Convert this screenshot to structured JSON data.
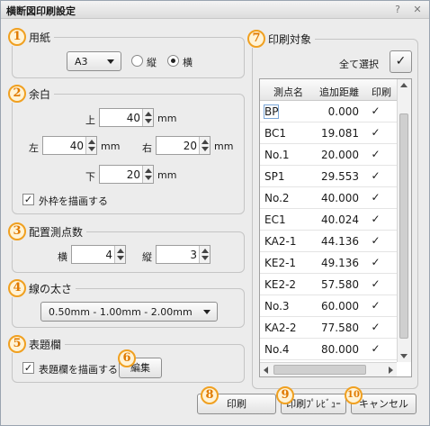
{
  "window": {
    "title": "横断図印刷設定",
    "help_icon": "?",
    "close_icon": "✕"
  },
  "paper": {
    "num": "1",
    "label": "用紙",
    "size_options": [
      "A3"
    ],
    "size_value": "A3",
    "orientation_portrait": "縦",
    "orientation_landscape": "横",
    "orientation_selected": "横"
  },
  "margin": {
    "num": "2",
    "label": "余白",
    "top_label": "上",
    "top_value": "40",
    "left_label": "左",
    "left_value": "40",
    "right_label": "右",
    "right_value": "20",
    "bottom_label": "下",
    "bottom_value": "20",
    "unit": "mm",
    "frame_check_label": "外枠を描画する",
    "frame_checked": true
  },
  "layout": {
    "num": "3",
    "label": "配置測点数",
    "horizontal_label": "横",
    "horizontal_value": "4",
    "vertical_label": "縦",
    "vertical_value": "3"
  },
  "line_width": {
    "num": "4",
    "label": "線の太さ",
    "value": "0.50mm - 1.00mm - 2.00mm"
  },
  "title_block": {
    "num": "5",
    "label": "表題欄",
    "draw_label": "表題欄を描画する",
    "draw_checked": true,
    "edit_num": "6",
    "edit_label": "編集"
  },
  "targets": {
    "num": "7",
    "label": "印刷対象",
    "select_all_label": "全て選択",
    "columns": [
      "測点名",
      "追加距離",
      "印刷"
    ],
    "rows": [
      {
        "name": "BP",
        "dist": "0.000",
        "print": "✓"
      },
      {
        "name": "BC1",
        "dist": "19.081",
        "print": "✓"
      },
      {
        "name": "No.1",
        "dist": "20.000",
        "print": "✓"
      },
      {
        "name": "SP1",
        "dist": "29.553",
        "print": "✓"
      },
      {
        "name": "No.2",
        "dist": "40.000",
        "print": "✓"
      },
      {
        "name": "EC1",
        "dist": "40.024",
        "print": "✓"
      },
      {
        "name": "KA2-1",
        "dist": "44.136",
        "print": "✓"
      },
      {
        "name": "KE2-1",
        "dist": "49.136",
        "print": "✓"
      },
      {
        "name": "KE2-2",
        "dist": "57.580",
        "print": "✓"
      },
      {
        "name": "No.3",
        "dist": "60.000",
        "print": "✓"
      },
      {
        "name": "KA2-2",
        "dist": "77.580",
        "print": "✓"
      },
      {
        "name": "No.4",
        "dist": "80.000",
        "print": "✓"
      }
    ]
  },
  "footer": {
    "print_num": "8",
    "print_label": "印刷",
    "preview_num": "9",
    "preview_label": "印刷ﾌﾟﾚﾋﾞｭｰ",
    "cancel_num": "10",
    "cancel_label": "キャンセル"
  }
}
